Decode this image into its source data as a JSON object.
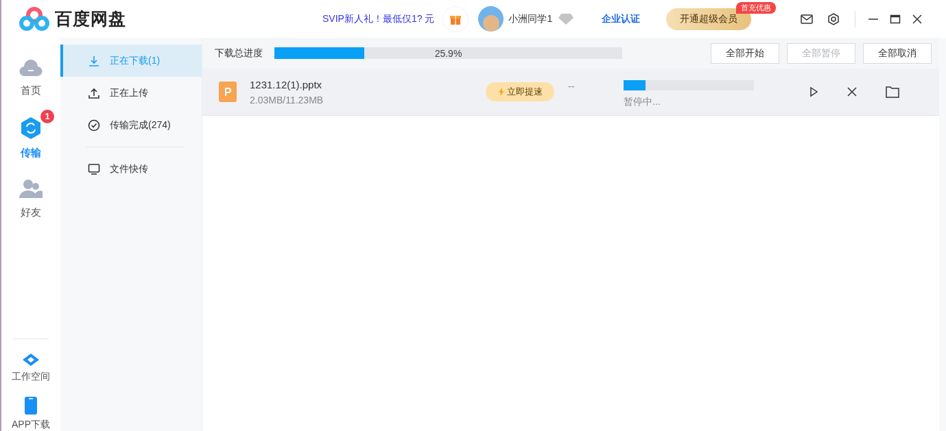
{
  "header": {
    "logo": "百度网盘",
    "promo": "SVIP新人礼！最低仅1? 元",
    "user_name": "小洲同学1",
    "enterprise": "企业认证",
    "vip_button": "开通超级会员",
    "vip_badge": "首充优惠"
  },
  "nav": [
    {
      "kind": "home",
      "label": "首页",
      "selected": false
    },
    {
      "kind": "transfer",
      "label": "传输",
      "selected": true,
      "badge": "1"
    },
    {
      "kind": "friends",
      "label": "好友",
      "selected": false
    }
  ],
  "nav_bottom": [
    {
      "kind": "workspace",
      "label": "工作空间"
    },
    {
      "kind": "app",
      "label": "APP下载"
    }
  ],
  "subnav": [
    {
      "kind": "download",
      "label": "正在下载(1)",
      "selected": true
    },
    {
      "kind": "upload",
      "label": "正在上传",
      "selected": false
    },
    {
      "kind": "done",
      "label": "传输完成(274)",
      "selected": false
    }
  ],
  "subnav_extra": [
    {
      "kind": "screen",
      "label": "文件快传",
      "selected": false
    }
  ],
  "total_progress": {
    "label": "下载总进度",
    "level": 0.259,
    "reading": "25.9%"
  },
  "buttons": [
    {
      "label": "全部开始",
      "disabled": false
    },
    {
      "label": "全部暂停",
      "disabled": true
    },
    {
      "label": "全部取消",
      "disabled": false
    }
  ],
  "downloads": [
    {
      "name": "1231.12(1).pptx",
      "size": "2.03MB/11.23MB",
      "boost": "立即提速",
      "speed": "--",
      "level": 0.17,
      "status": "暂停中..."
    }
  ]
}
